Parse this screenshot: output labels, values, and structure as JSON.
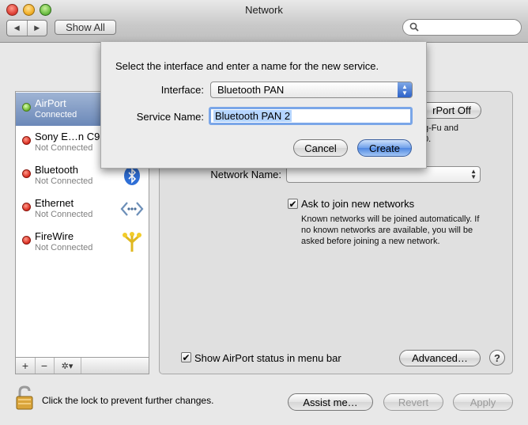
{
  "window": {
    "title": "Network"
  },
  "toolbar": {
    "back_glyph": "◀",
    "forward_glyph": "▶",
    "show_all": "Show All",
    "search_placeholder": ""
  },
  "sidebar": {
    "items": [
      {
        "name": "AirPort",
        "status": "Connected",
        "status_color": "green",
        "icon": "airport-wifi-icon",
        "selected": true
      },
      {
        "name": "Sony E…n C9",
        "status": "Not Connected",
        "status_color": "red",
        "icon": "phone-icon",
        "selected": false
      },
      {
        "name": "Bluetooth",
        "status": "Not Connected",
        "status_color": "red",
        "icon": "bluetooth-icon",
        "selected": false
      },
      {
        "name": "Ethernet",
        "status": "Not Connected",
        "status_color": "red",
        "icon": "ethernet-icon",
        "selected": false
      },
      {
        "name": "FireWire",
        "status": "Not Connected",
        "status_color": "red",
        "icon": "firewire-icon",
        "selected": false
      }
    ],
    "footer": {
      "add": "+",
      "remove": "−",
      "gear": "✲▾"
    }
  },
  "main": {
    "airport_off_button": "rPort Off",
    "airport_info_line1": "g-Fu and",
    "airport_info_line2": "0.",
    "network_name_label": "Network Name:",
    "network_name_value": "",
    "ask_to_join_label": "Ask to join new networks",
    "ask_to_join_checked": true,
    "known_networks_text": "Known networks will be joined automatically. If no known networks are available, you will be asked before joining a new network.",
    "show_status_label": "Show AirPort status in menu bar",
    "show_status_checked": true,
    "advanced_button": "Advanced…",
    "help_button": "?"
  },
  "bottom": {
    "lock_text": "Click the lock to prevent further changes.",
    "assist_button": "Assist me…",
    "revert_button": "Revert",
    "apply_button": "Apply"
  },
  "sheet": {
    "prompt": "Select the interface and enter a name for the new service.",
    "interface_label": "Interface:",
    "interface_value": "Bluetooth PAN",
    "service_name_label": "Service Name:",
    "service_name_value": "Bluetooth PAN 2",
    "cancel_button": "Cancel",
    "create_button": "Create"
  },
  "colors": {
    "selection": "#7f99c4",
    "default_button": "#5a8fe4",
    "focus_ring": "#7aa6e8"
  }
}
